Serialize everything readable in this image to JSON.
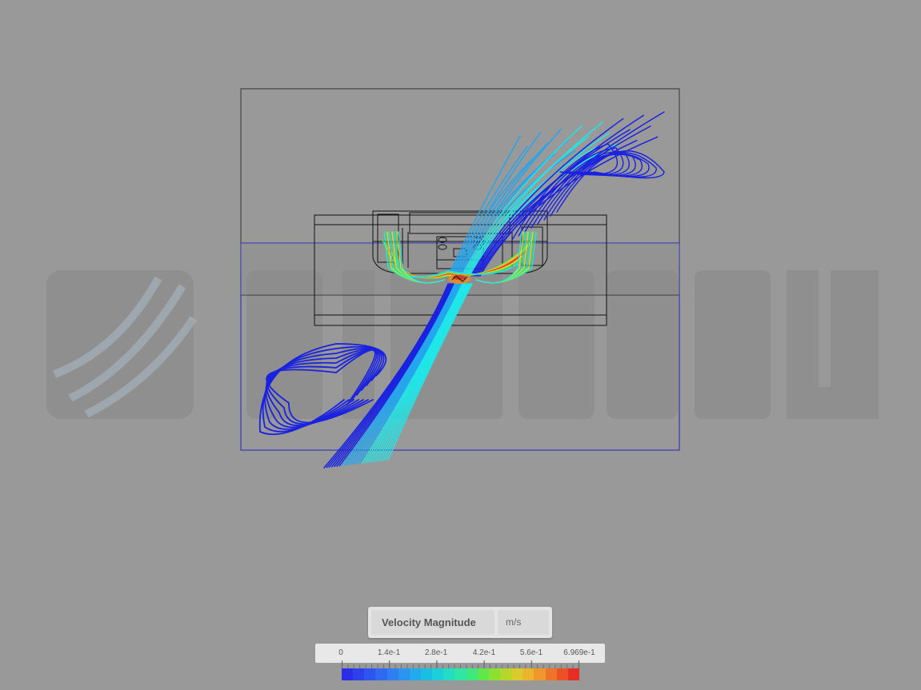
{
  "viewer": {
    "watermark_text": "SIMSCALE",
    "background_color": "#999999"
  },
  "legend": {
    "quantity": "Velocity Magnitude",
    "unit": "m/s",
    "ticks": [
      "0",
      "1.4e-1",
      "2.8e-1",
      "4.2e-1",
      "5.6e-1",
      "6.969e-1"
    ],
    "min": 0,
    "max": 0.6969,
    "colors": [
      "#2a2ee8",
      "#2c40ec",
      "#2e55ee",
      "#2f6af0",
      "#2e7ff0",
      "#2b94ee",
      "#22aaea",
      "#1cbde4",
      "#1ccfd8",
      "#22dcc4",
      "#2ee6a6",
      "#3ee87e",
      "#5ee84c",
      "#8ce030",
      "#b6d62a",
      "#d8cb2c",
      "#ecb42c",
      "#f0962a",
      "#ee7428",
      "#ea5226",
      "#e62e24"
    ]
  },
  "scene": {
    "streamline_colors": {
      "slow": "#1a22e0",
      "mid": "#23a6ee",
      "cyan": "#20e6e8",
      "green": "#48e04a",
      "yellow": "#e2e030",
      "orange": "#ef8a28",
      "red": "#e63226"
    },
    "outline_color": "#111111",
    "domain_color": "#2222bb"
  }
}
